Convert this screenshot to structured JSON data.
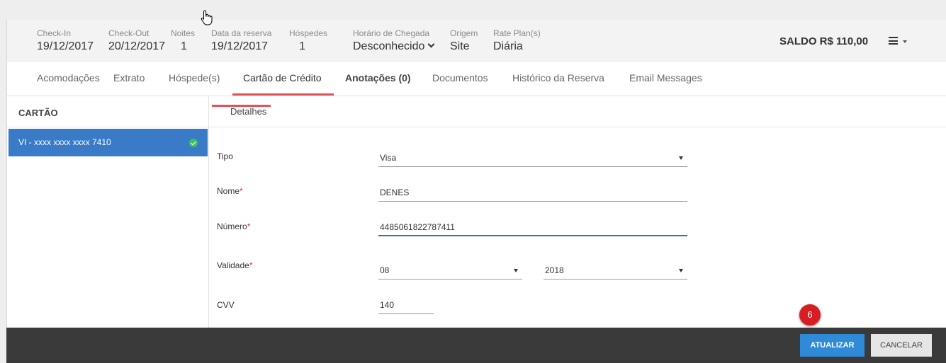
{
  "header": {
    "fields": [
      {
        "label": "Check-In",
        "value": "19/12/2017"
      },
      {
        "label": "Check-Out",
        "value": "20/12/2017"
      },
      {
        "label": "Noites",
        "value": "1"
      },
      {
        "label": "Data da reserva",
        "value": "19/12/2017"
      },
      {
        "label": "Hóspedes",
        "value": "1"
      },
      {
        "label": "Horário de Chegada",
        "value": "Desconhecido"
      },
      {
        "label": "Origem",
        "value": "Site"
      },
      {
        "label": "Rate Plan(s)",
        "value": "Diária"
      }
    ],
    "saldo": "SALDO R$ 110,00",
    "menu_icon": "hamburger-menu-icon"
  },
  "tabs": [
    {
      "label": "Acomodações"
    },
    {
      "label": "Extrato"
    },
    {
      "label": "Hóspede(s)"
    },
    {
      "label": "Cartão de Crédito",
      "active": true
    },
    {
      "label": "Anotações (0)"
    },
    {
      "label": "Documentos"
    },
    {
      "label": "Histórico da Reserva"
    },
    {
      "label": "Email Messages"
    }
  ],
  "sidebar": {
    "title": "CARTÃO",
    "cards": [
      {
        "label": "VI - xxxx xxxx xxxx 7410",
        "selected": true,
        "status_icon": "check-circle-icon",
        "status_color": "#3fbf6a"
      }
    ]
  },
  "details": {
    "subtab": "Detalhes",
    "tipo": {
      "label": "Tipo",
      "value": "Visa"
    },
    "nome": {
      "label": "Nome",
      "value": "DENES"
    },
    "numero": {
      "label": "Número",
      "value": "4485061822787411"
    },
    "validade": {
      "label": "Validade",
      "month": "08",
      "year": "2018"
    },
    "cvv": {
      "label": "CVV",
      "value": "140"
    },
    "required_marker": "*"
  },
  "footer": {
    "update_label": "ATUALIZAR",
    "cancel_label": "CANCELAR"
  },
  "annotation": {
    "step": "6",
    "color": "#d81e23"
  },
  "colors": {
    "accent": "#e2525c",
    "primary": "#2f8ad8",
    "selected": "#3a7bc8"
  }
}
